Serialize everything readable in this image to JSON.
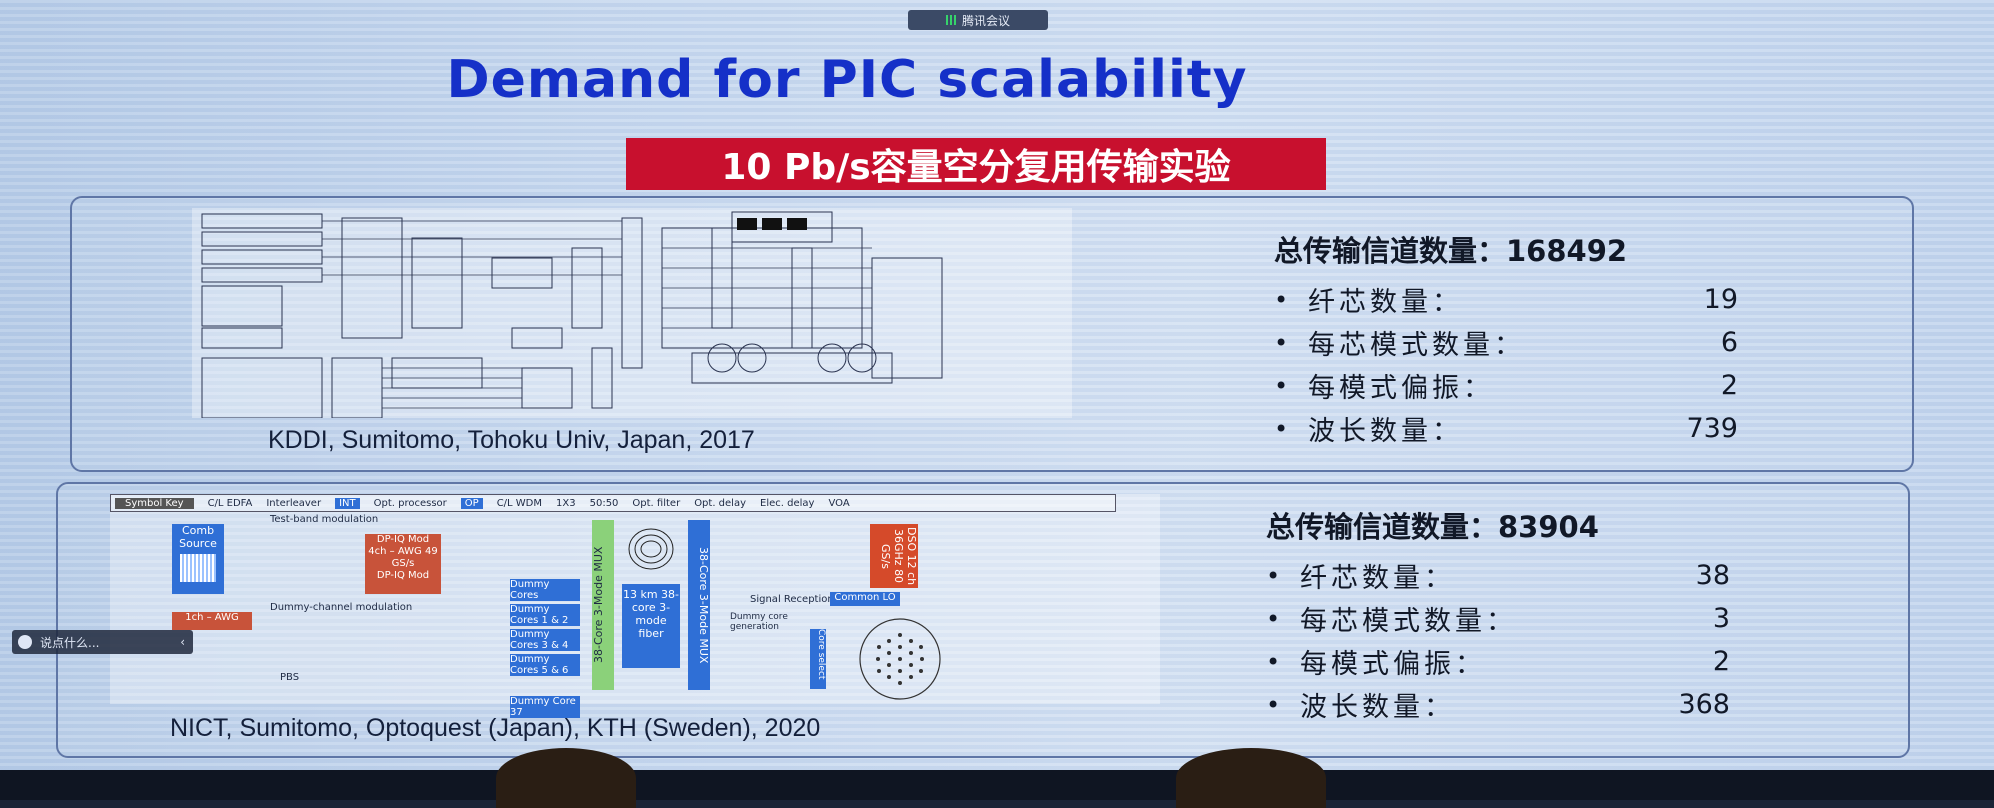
{
  "meeting_badge": "腾讯会议",
  "slide": {
    "title": "Demand for PIC scalability",
    "subtitle": "10 Pb/s容量空分复用传输实验",
    "experiments": [
      {
        "caption": "KDDI, Sumitomo, Tohoku Univ, Japan, 2017",
        "total_label": "总传输信道数量：168492",
        "rows": [
          {
            "label": "纤芯数量：",
            "value": "19"
          },
          {
            "label": "每芯模式数量：",
            "value": "6"
          },
          {
            "label": "每模式偏振：",
            "value": "2"
          },
          {
            "label": "波长数量：",
            "value": "739"
          }
        ]
      },
      {
        "caption": "NICT, Sumitomo, Optoquest (Japan), KTH (Sweden), 2020",
        "total_label": "总传输信道数量：83904",
        "rows": [
          {
            "label": "纤芯数量：",
            "value": "38"
          },
          {
            "label": "每芯模式数量：",
            "value": "3"
          },
          {
            "label": "每模式偏振：",
            "value": "2"
          },
          {
            "label": "波长数量：",
            "value": "368"
          }
        ]
      }
    ],
    "diagram2_labels": {
      "symbol_key": "Symbol Key",
      "edfa": "C/L EDFA",
      "interleaver": "Interleaver",
      "int": "INT",
      "opt_processor": "Opt. processor",
      "op": "OP",
      "wdm": "C/L WDM",
      "coupler_1x3": "1X3",
      "coupler_5050": "50:50",
      "opt_filter": "Opt. filter",
      "opt_delay": "Opt. delay",
      "elec_delay": "Elec. delay",
      "voa": "VOA",
      "comb_source": "Comb Source",
      "test_band": "Test-band modulation",
      "dpiq_mod": "DP-IQ Mod",
      "awg_4ch": "4ch – AWG 49 GS/s",
      "dummy_mod": "Dummy-channel modulation",
      "awg_1ch": "1ch – AWG",
      "fiber": "13 km 38-core 3-mode fiber",
      "mux_in": "38-Core 3-Mode MUX",
      "mux_out": "38-Core 3-Mode MUX",
      "signal_reception": "Signal Reception",
      "dso": "DSO 12 ch 36GHz 80 GS/s",
      "common_lo": "Common LO",
      "dummy_cores": [
        "Dummy Cores",
        "Dummy Cores 1 & 2",
        "Dummy Cores 3 & 4",
        "Dummy Cores 5 & 6",
        "Dummy Core 37"
      ],
      "dummy_gen": "Dummy core generation",
      "core_select": "Core select",
      "pbs": "PBS"
    }
  },
  "overlay_bar": {
    "text": "说点什么...",
    "collapse_icon": "chevron-left-icon"
  }
}
